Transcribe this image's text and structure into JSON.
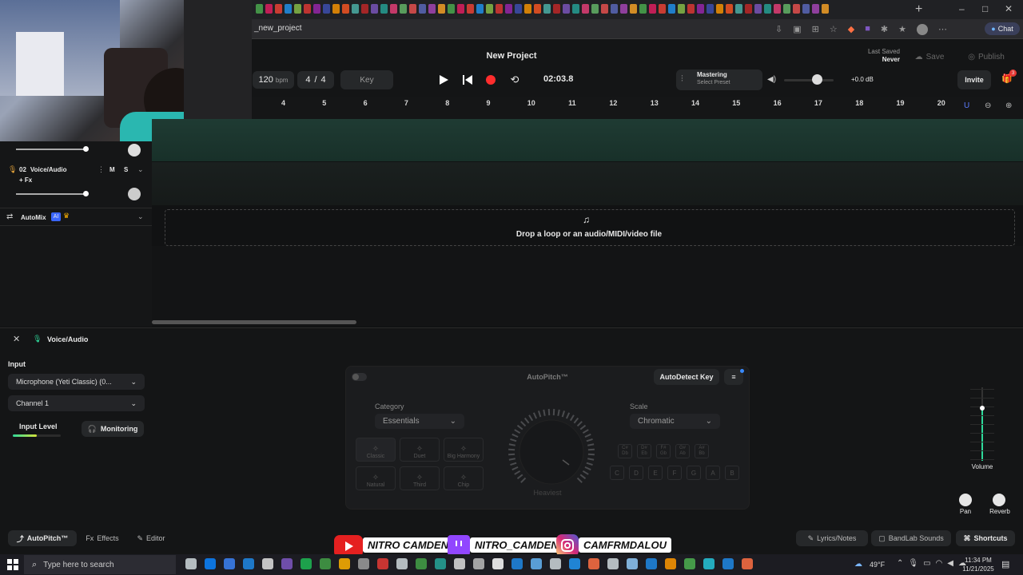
{
  "browser": {
    "url": "_new_project",
    "tab_icon_colors": [
      "#4caf50",
      "#e91e63",
      "#f44336",
      "#2196f3",
      "#8bc34a",
      "#e53935",
      "#9c27b0",
      "#3f51b5",
      "#ff9800",
      "#ff5722",
      "#4db6ac",
      "#c62828",
      "#7e57c2",
      "#26a69a",
      "#ec407a",
      "#66bb6a",
      "#ef5350",
      "#5c6bc0",
      "#ab47bc",
      "#ffa726"
    ]
  },
  "project": {
    "title": "New Project",
    "last_saved_label": "Last Saved",
    "last_saved_value": "Never",
    "save_label": "Save",
    "publish_label": "Publish",
    "invite_label": "Invite",
    "notification_count": "3"
  },
  "transport": {
    "bpm_value": "120",
    "bpm_unit": "bpm",
    "time_sig_top": "4",
    "time_sig_sep": "/",
    "time_sig_bottom": "4",
    "key_label": "Key",
    "time": "02:03.8",
    "mastering_label": "Mastering",
    "mastering_preset": "Select Preset",
    "master_db": "+0.0 dB"
  },
  "ruler": {
    "ticks": [
      "4",
      "5",
      "6",
      "7",
      "8",
      "9",
      "10",
      "11",
      "12",
      "13",
      "14",
      "15",
      "16",
      "17",
      "18",
      "19",
      "20"
    ]
  },
  "tracks": [
    {
      "number": "02",
      "name": "Voice/Audio",
      "mute": "M",
      "solo": "S",
      "fx": "+ Fx"
    }
  ],
  "automix": {
    "label": "AutoMix",
    "badge": "AI"
  },
  "dropzone": {
    "text": "Drop a loop or an audio/MIDI/video file"
  },
  "inspector": {
    "track_name": "Voice/Audio",
    "input_label": "Input",
    "input_device": "Microphone (Yeti Classic) (0...",
    "channel": "Channel 1",
    "input_level_label": "Input Level",
    "monitoring_label": "Monitoring",
    "input_level": 0.5
  },
  "autopitch": {
    "title": "AutoPitch™",
    "autodetect_label": "AutoDetect Key",
    "category_label": "Category",
    "category_value": "Essentials",
    "scale_label": "Scale",
    "scale_value": "Chromatic",
    "presets": [
      "Classic",
      "Duet",
      "Big Harmony",
      "Natural",
      "Third",
      "Chip"
    ],
    "knob_label": "Heaviest",
    "accidentals": [
      [
        "C#",
        "Db"
      ],
      [
        "D#",
        "Eb"
      ],
      [
        "F#",
        "Gb"
      ],
      [
        "G#",
        "Ab"
      ],
      [
        "A#",
        "Bb"
      ]
    ],
    "notes": [
      "C",
      "D",
      "E",
      "F",
      "G",
      "A",
      "B"
    ]
  },
  "mixer": {
    "volume_label": "Volume",
    "pan_label": "Pan",
    "reverb_label": "Reverb"
  },
  "footer": {
    "tab_autopitch": "AutoPitch™",
    "tab_effects": "Effects",
    "tab_editor": "Editor",
    "lyrics": "Lyrics/Notes",
    "sounds": "BandLab Sounds",
    "shortcuts": "Shortcuts"
  },
  "overlay": {
    "youtube": "NITRO CAMDEN",
    "twitch": "NITRO_CAMDEN",
    "instagram": "CAMFRMDALOU"
  },
  "taskbar": {
    "search_placeholder": "Type here to search",
    "weather": "49°F",
    "time": "11:34 PM",
    "date": "11/21/2025"
  },
  "colors": {
    "accent": "#2fd89a",
    "record": "#ff2d2d",
    "background": "#111213"
  }
}
